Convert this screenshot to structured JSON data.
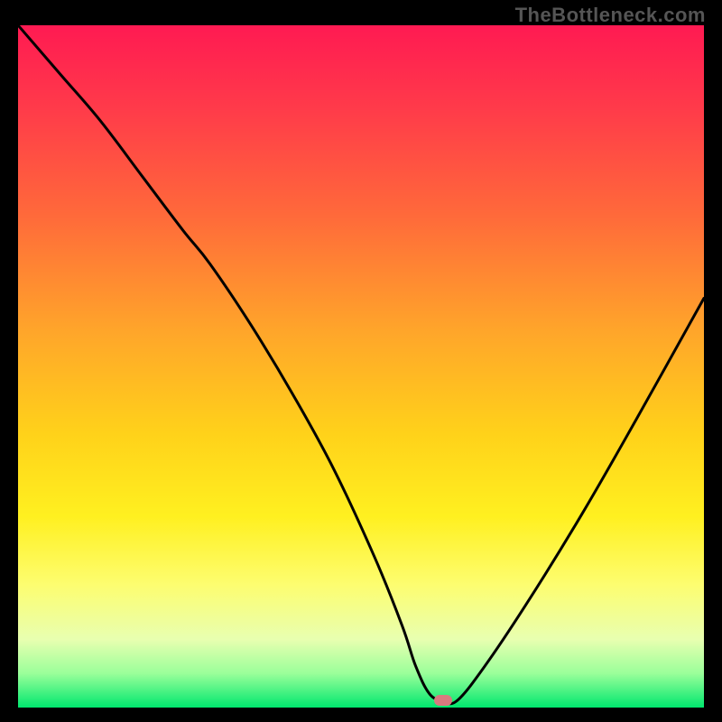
{
  "watermark": "TheBottleneck.com",
  "colors": {
    "gradient_stops": [
      {
        "pct": 0,
        "color": "#ff1a52"
      },
      {
        "pct": 12,
        "color": "#ff3a4a"
      },
      {
        "pct": 28,
        "color": "#ff6a3a"
      },
      {
        "pct": 45,
        "color": "#ffa62a"
      },
      {
        "pct": 60,
        "color": "#ffd21a"
      },
      {
        "pct": 72,
        "color": "#fff020"
      },
      {
        "pct": 82,
        "color": "#fdfd70"
      },
      {
        "pct": 90,
        "color": "#e8ffb0"
      },
      {
        "pct": 95,
        "color": "#9aff9a"
      },
      {
        "pct": 100,
        "color": "#00e76e"
      }
    ],
    "curve": "#000000",
    "marker": "#d97a7f",
    "frame": "#000000"
  },
  "chart_data": {
    "type": "line",
    "title": "",
    "xlabel": "",
    "ylabel": "",
    "xlim": [
      0,
      100
    ],
    "ylim": [
      0,
      100
    ],
    "series": [
      {
        "name": "bottleneck-curve",
        "x": [
          0,
          6,
          12,
          18,
          24,
          28,
          34,
          40,
          46,
          52,
          56,
          58,
          60,
          62,
          64,
          68,
          74,
          82,
          90,
          100
        ],
        "y": [
          100,
          93,
          86,
          78,
          70,
          65,
          56,
          46,
          35,
          22,
          12,
          6,
          2,
          1,
          1,
          6,
          15,
          28,
          42,
          60
        ]
      }
    ],
    "flat_bottom": {
      "x_start": 58,
      "x_end": 64,
      "y": 1
    },
    "marker": {
      "x": 62,
      "y": 1
    }
  }
}
